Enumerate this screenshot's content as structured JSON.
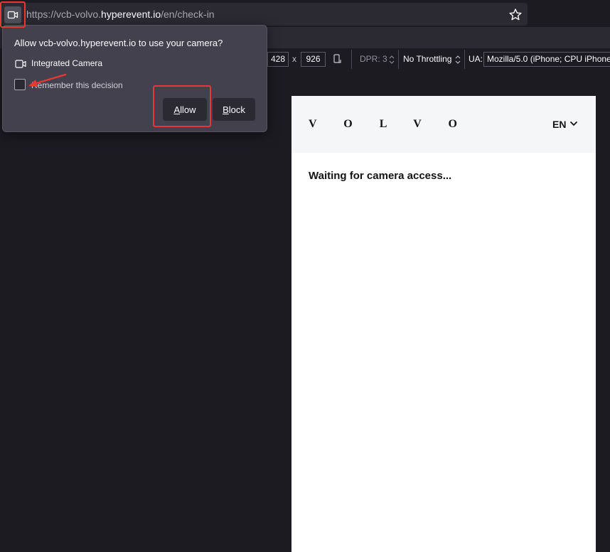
{
  "browser": {
    "url": {
      "prefix": "https://vcb-volvo.",
      "host": "hyperevent.io",
      "path": "/en/check-in"
    }
  },
  "responsive_toolbar": {
    "width": "428",
    "separator": "x",
    "height": "926",
    "dpr": "DPR: 3",
    "throttling": "No Throttling",
    "ua_label": "UA:",
    "ua_value": "Mozilla/5.0 (iPhone; CPU iPhone"
  },
  "permission_popup": {
    "title": "Allow vcb-volvo.hyperevent.io to use your camera?",
    "device": "Integrated Camera",
    "remember_label": "Remember this decision",
    "remember_checked": false,
    "allow": {
      "underlined": "A",
      "rest": "llow"
    },
    "block": {
      "underlined": "B",
      "rest": "lock"
    }
  },
  "page": {
    "logo": "V O L V O",
    "language": "EN",
    "status": "Waiting for camera access..."
  },
  "colors": {
    "highlight": "#e53935",
    "popup_bg": "#42414d",
    "viewport_header": "#f5f6f8"
  }
}
